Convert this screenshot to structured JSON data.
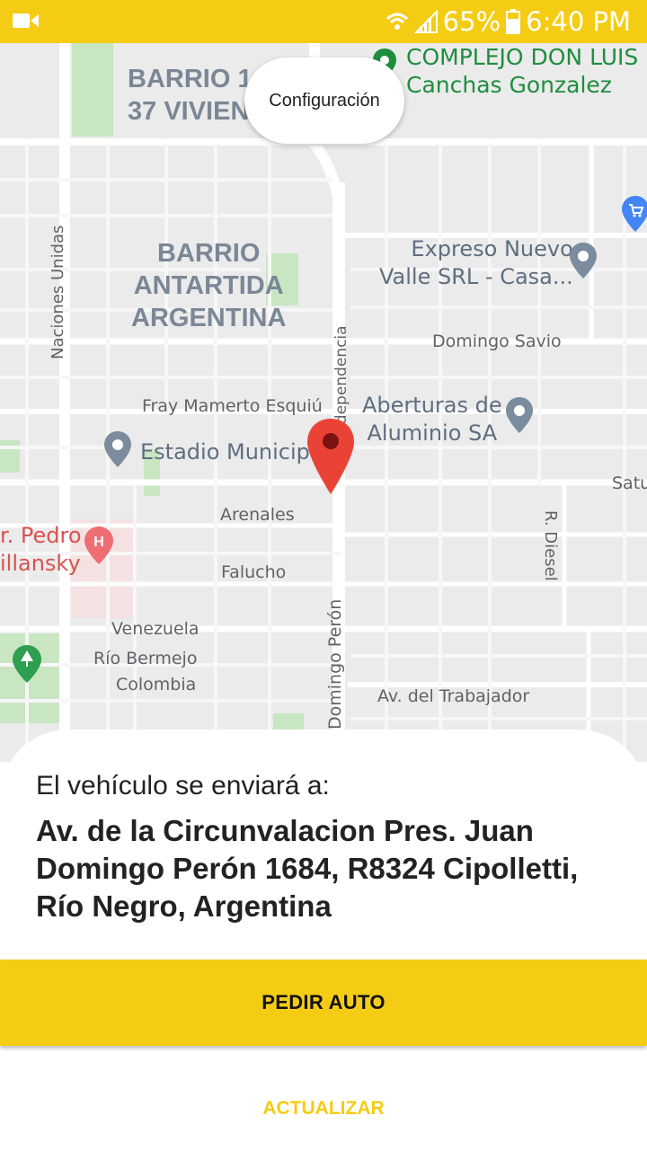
{
  "status_bar": {
    "battery": "65%",
    "time": "6:40 PM",
    "icons": [
      "video-camera-icon",
      "wifi-icon",
      "signal-icon",
      "battery-icon"
    ]
  },
  "map": {
    "areas": {
      "barrio_top": "BARRIO 1\n37 VIVIEN",
      "barrio_antartida": "BARRIO\nANTARTIDA\nARGENTINA"
    },
    "streets": {
      "naciones_unidas": "Naciones Unidas",
      "domingo_savio": "Domingo Savio",
      "fray_mamerto": "Fray Mamerto Esquiú",
      "arenales": "Arenales",
      "falucho": "Falucho",
      "venezuela": "Venezuela",
      "rio_bermejo": "Río Bermejo",
      "colombia": "Colombia",
      "av_trabajador": "Av. del Trabajador",
      "domingo_peron": "Domingo Perón",
      "r_diesel": "R. Diesel",
      "independencia": "Independencia",
      "satu": "Satu"
    },
    "pois": {
      "complejo": "COMPLEJO DON LUIS\nCanchas Gonzalez",
      "expreso": "Expreso Nuevo\nValle SRL - Casa...",
      "aberturas": "Aberturas de\nAluminio SA",
      "estadio": "Estadio Municipal",
      "hospital": "r. Pedro\nillansky"
    },
    "colors": {
      "background": "#ebebeb",
      "road": "#ffffff",
      "park": "#c9e6c3",
      "pin": "#ea4335",
      "poi_marker": "#7a8c9e",
      "hospital_marker": "#ee6e73"
    }
  },
  "config_button": {
    "label": "Configuración"
  },
  "sheet": {
    "caption": "El vehículo se enviará a:",
    "address": "Av. de la Circunvalacion Pres. Juan Domingo Perón 1684, R8324 Cipolletti, Río Negro, Argentina"
  },
  "actions": {
    "primary": "PEDIR AUTO",
    "secondary": "ACTUALIZAR",
    "accent": "#f5cc14"
  }
}
